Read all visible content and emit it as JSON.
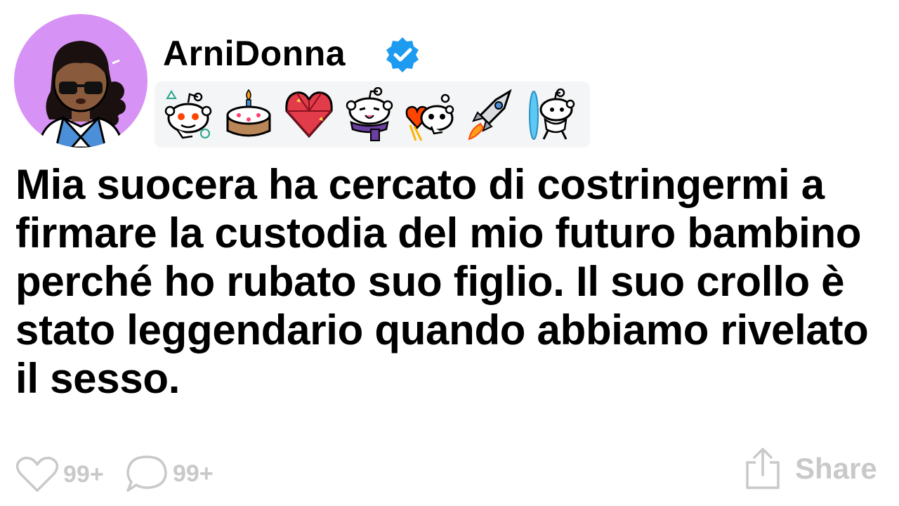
{
  "post": {
    "author": "ArniDonna",
    "title": "Mia suocera ha cercato di costringermi a firmare la custodia del mio futuro bambino perché ho rubato suo figlio. Il suo crollo è stato leggendario quando abbiamo rivelato il sesso."
  },
  "trophies": [
    "avatar-snoo-trophy-icon",
    "cake-day-trophy-icon",
    "gem-heart-trophy-icon",
    "scarf-snoo-trophy-icon",
    "heart-snoo-trophy-icon",
    "rocket-trophy-icon",
    "portal-snoo-trophy-icon"
  ],
  "footer": {
    "likes": "99+",
    "comments": "99+",
    "share_label": "Share"
  },
  "colors": {
    "avatar_bg": "#d792f5",
    "verified": "#1d9bf0",
    "muted": "#c9c9c9",
    "trophy_bg": "#f4f5f6"
  }
}
